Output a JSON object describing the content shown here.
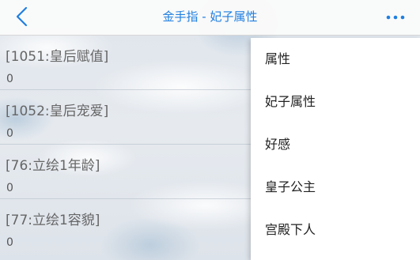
{
  "header": {
    "title": "金手指 - 妃子属性"
  },
  "rows": [
    {
      "label": "[1051:皇后赋值]",
      "value": "0"
    },
    {
      "label": "[1052:皇后宠爱]",
      "value": "0"
    },
    {
      "label": "[76:立绘1年龄]",
      "value": "0"
    },
    {
      "label": "[77:立绘1容貌]",
      "value": "0"
    }
  ],
  "menu": {
    "items": [
      "属性",
      "妃子属性",
      "好感",
      "皇子公主",
      "宫殿下人"
    ]
  },
  "colors": {
    "accent": "#1f7fe0",
    "header_bg": "#fafafa",
    "menu_bg": "#ffffff"
  }
}
